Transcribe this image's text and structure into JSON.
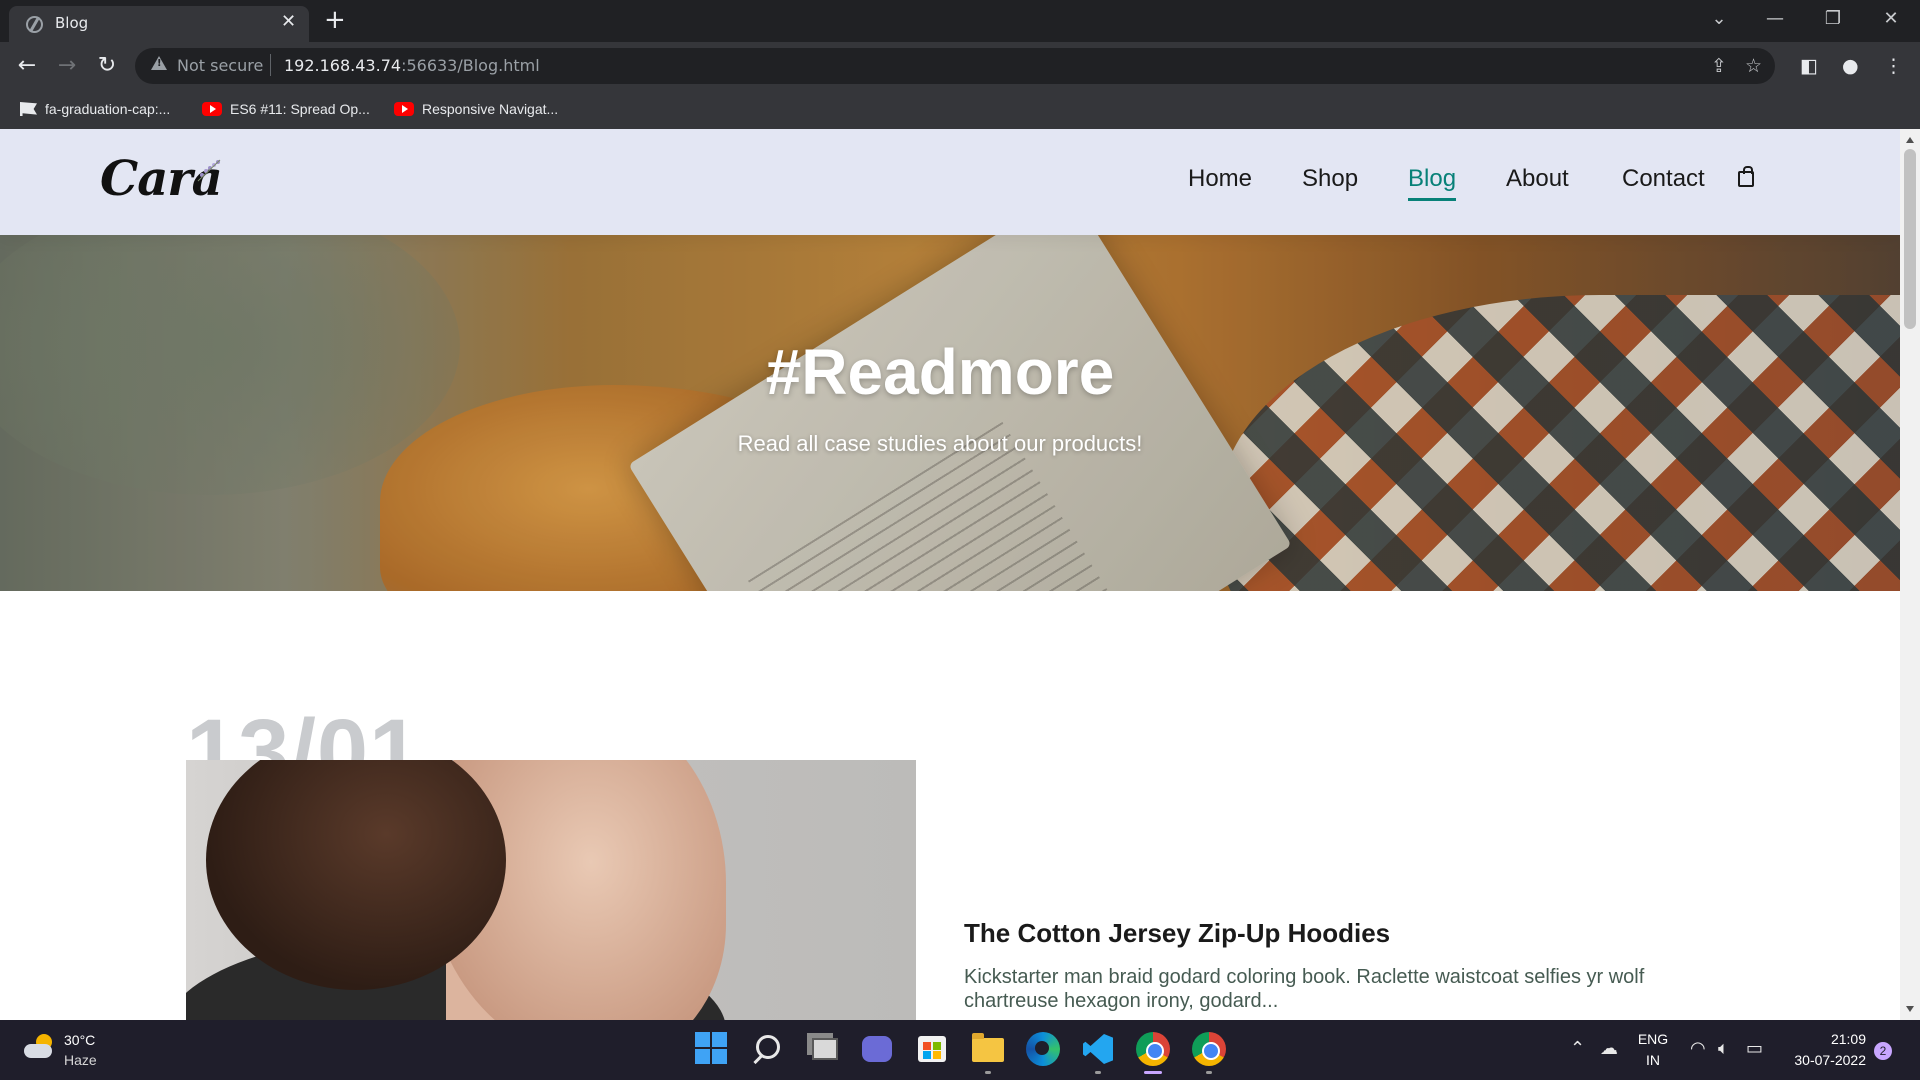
{
  "browser": {
    "tab_title": "Blog",
    "tab_close": "✕",
    "new_tab": "+",
    "window_controls": {
      "tab_search": "⌄",
      "minimize": "—",
      "restore": "❐",
      "close": "✕"
    },
    "security_label": "Not secure",
    "url_host": "192.168.43.74",
    "url_rest": ":56633/Blog.html",
    "bookmarks": [
      {
        "label": "fa-graduation-cap:...",
        "icon": "flag-icon"
      },
      {
        "label": "ES6 #11: Spread Op...",
        "icon": "youtube-icon"
      },
      {
        "label": "Responsive Navigat...",
        "icon": "youtube-icon"
      }
    ]
  },
  "site": {
    "logo": "Cara",
    "nav": [
      {
        "label": "Home",
        "active": false
      },
      {
        "label": "Shop",
        "active": false
      },
      {
        "label": "Blog",
        "active": true
      },
      {
        "label": "About",
        "active": false
      },
      {
        "label": "Contact",
        "active": false
      }
    ],
    "accent_color": "#088178",
    "header_bg": "#e3e6f3",
    "hero": {
      "title": "#Readmore",
      "subtitle": "Read all case studies about our products!"
    },
    "blog_post": {
      "date": "13/01",
      "title": "The Cotton Jersey Zip-Up Hoodies",
      "excerpt": "Kickstarter man braid godard coloring book. Raclette waistcoat selfies yr wolf chartreuse hexagon irony, godard..."
    }
  },
  "taskbar": {
    "weather_temp": "30°C",
    "weather_desc": "Haze",
    "language": "ENG",
    "region": "IN",
    "time": "21:09",
    "date": "30-07-2022",
    "notifications": "2"
  }
}
